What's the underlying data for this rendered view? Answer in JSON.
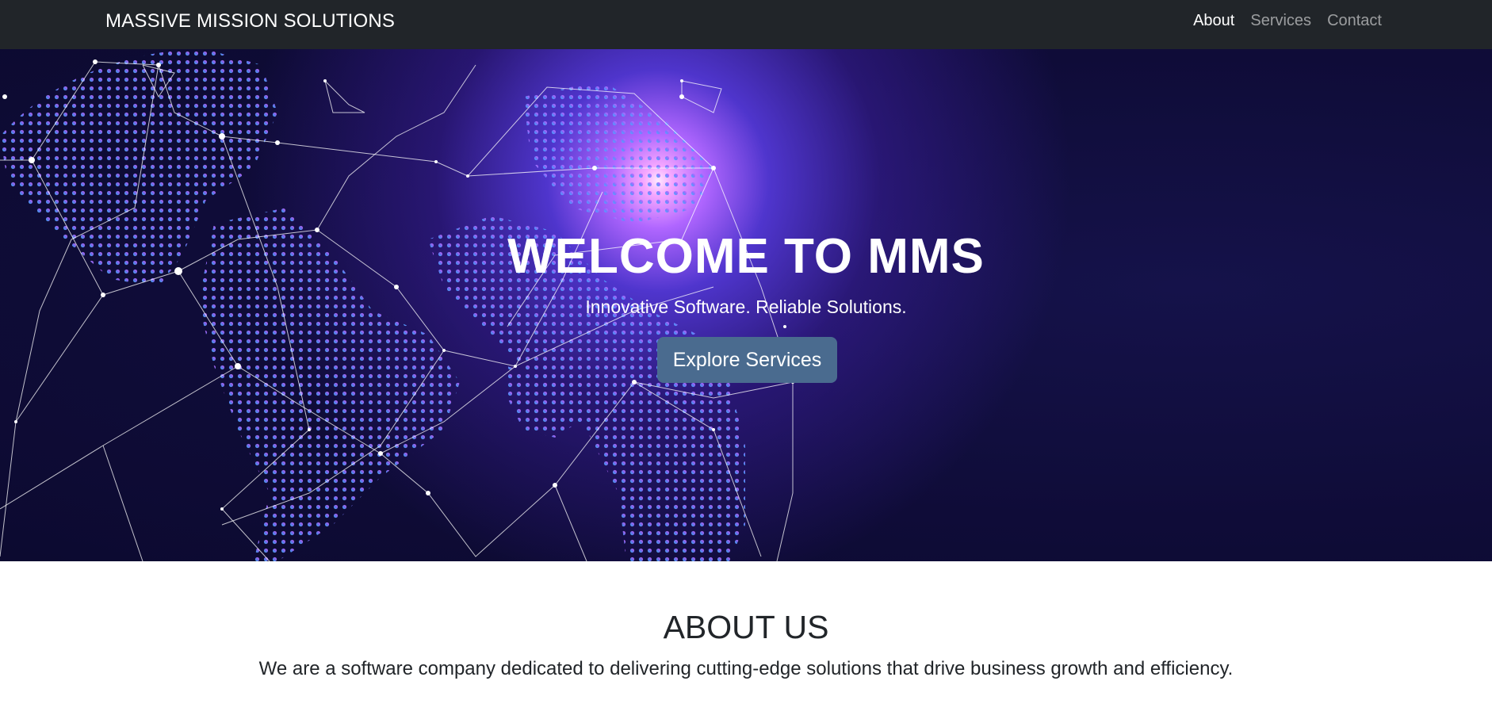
{
  "navbar": {
    "brand": "MASSIVE MISSION SOLUTIONS",
    "links": [
      {
        "label": "About",
        "active": true
      },
      {
        "label": "Services",
        "active": false
      },
      {
        "label": "Contact",
        "active": false
      }
    ]
  },
  "hero": {
    "title": "WELCOME TO MMS",
    "subtitle": "Innovative Software. Reliable Solutions.",
    "button_label": "Explore Services",
    "background_image": "digital-globe-network-image"
  },
  "about": {
    "title": "ABOUT US",
    "text": "We are a software company dedicated to delivering cutting-edge solutions that drive business growth and efficiency."
  },
  "colors": {
    "navbar_bg": "#212529",
    "hero_bg": "#120f3f",
    "button_bg": "#4a6b8f",
    "accent_glow": "#b066ff"
  }
}
